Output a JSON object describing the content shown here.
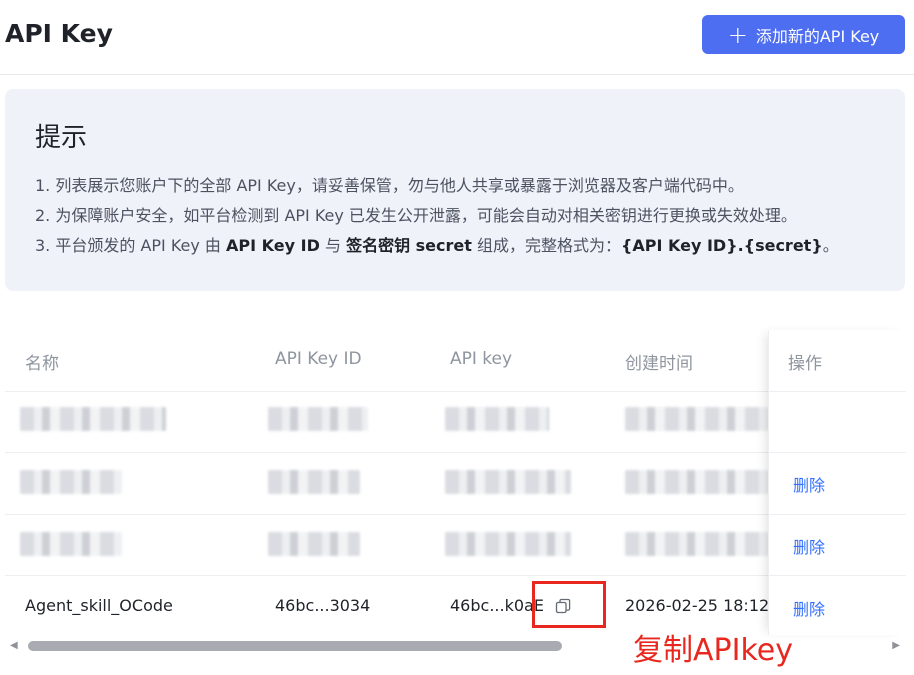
{
  "header": {
    "title": "API Key",
    "add_button_label": "添加新的API Key",
    "add_icon": "+"
  },
  "tips": {
    "title": "提示",
    "line1": "1. 列表展示您账户下的全部 API Key，请妥善保管，勿与他人共享或暴露于浏览器及客户端代码中。",
    "line2": "2. 为保障账户安全，如平台检测到 API Key 已发生公开泄露，可能会自动对相关密钥进行更换或失效处理。",
    "line3": {
      "p1": "3. 平台颁发的 API Key 由 ",
      "b1": "API Key ID",
      "p2": " 与 ",
      "b2": "签名密钥 secret",
      "p3": " 组成，完整格式为：",
      "b3": "{API Key ID}.{secret}",
      "p4": "。"
    }
  },
  "table": {
    "columns": [
      "名称",
      "API Key ID",
      "API key",
      "创建时间",
      "操作"
    ],
    "rows": [
      {
        "name": "",
        "key_id": "",
        "api_key": "",
        "created": "",
        "action": ""
      },
      {
        "name": "",
        "key_id": "",
        "api_key": "",
        "created": "",
        "action": "删除"
      },
      {
        "name": "",
        "key_id": "",
        "api_key": "",
        "created": "",
        "action": "删除"
      },
      {
        "name": "Agent_skill_OCode",
        "key_id": "46bc...3034",
        "api_key": "46bc...k0aE",
        "created": "2026-02-25 18:12:",
        "action": "删除"
      }
    ]
  },
  "annotation": {
    "text": "复制APIkey",
    "color": "#e8281e"
  },
  "colors": {
    "primary": "#4e6ef2",
    "link": "#3370ff",
    "tips_bg": "#f0f2fa"
  },
  "icons": {
    "copy": "copy-icon",
    "scroll_left": "◀",
    "scroll_right": "▶"
  }
}
